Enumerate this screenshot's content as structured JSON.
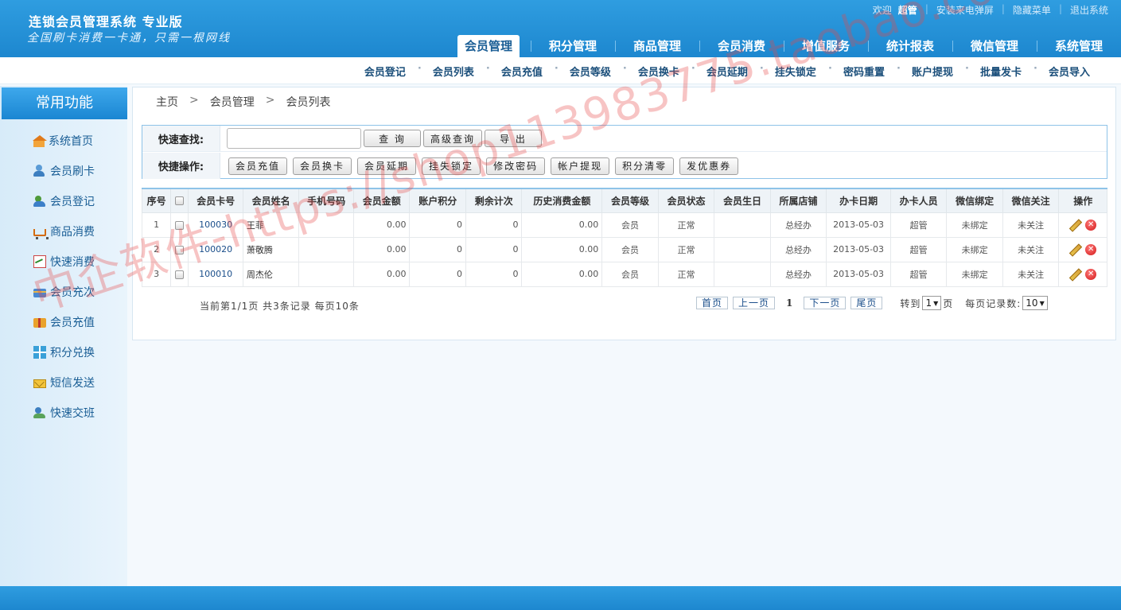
{
  "app": {
    "title": "连锁会员管理系统 专业版",
    "slogan": "全国刷卡消费一卡通，只需一根网线"
  },
  "toplinks": {
    "welcome": "欢迎",
    "user": "超管",
    "install": "安装来电弹屏",
    "hide_menu": "隐藏菜单",
    "logout": "退出系统"
  },
  "mainnav": [
    "会员管理",
    "积分管理",
    "商品管理",
    "会员消费",
    "增值服务",
    "统计报表",
    "微信管理",
    "系统管理"
  ],
  "subnav": [
    "会员登记",
    "会员列表",
    "会员充值",
    "会员等级",
    "会员换卡",
    "会员延期",
    "挂失锁定",
    "密码重置",
    "账户提现",
    "批量发卡",
    "会员导入"
  ],
  "sidebar": {
    "title": "常用功能",
    "items": [
      {
        "label": "系统首页",
        "icon": "home-icon"
      },
      {
        "label": "会员刷卡",
        "icon": "user-card-icon"
      },
      {
        "label": "会员登记",
        "icon": "users-icon"
      },
      {
        "label": "商品消费",
        "icon": "cart-icon"
      },
      {
        "label": "快速消费",
        "icon": "chart-icon"
      },
      {
        "label": "会员充次",
        "icon": "card-icon"
      },
      {
        "label": "会员充值",
        "icon": "box-icon"
      },
      {
        "label": "积分兑换",
        "icon": "gift-icon"
      },
      {
        "label": "短信发送",
        "icon": "mail-icon"
      },
      {
        "label": "快速交班",
        "icon": "shift-icon"
      }
    ]
  },
  "breadcrumb": [
    "主页",
    "会员管理",
    "会员列表"
  ],
  "search": {
    "label": "快速查找:",
    "value": "",
    "query_btn": "查 询",
    "advanced_btn": "高级查询",
    "export_btn": "导 出"
  },
  "quick": {
    "label": "快捷操作:",
    "buttons": [
      "会员充值",
      "会员换卡",
      "会员延期",
      "挂失锁定",
      "修改密码",
      "帐户提现",
      "积分清零",
      "发优惠券"
    ]
  },
  "table": {
    "columns": [
      "序号",
      "",
      "会员卡号",
      "会员姓名",
      "手机号码",
      "会员金额",
      "账户积分",
      "剩余计次",
      "历史消费金额",
      "会员等级",
      "会员状态",
      "会员生日",
      "所属店铺",
      "办卡日期",
      "办卡人员",
      "微信绑定",
      "微信关注",
      "操作"
    ],
    "rows": [
      {
        "no": "1",
        "card": "100030",
        "name": "王菲",
        "phone": "",
        "amount": "0.00",
        "points": "0",
        "times": "0",
        "history": "0.00",
        "level": "会员",
        "status": "正常",
        "birthday": "",
        "store": "总经办",
        "date": "2013-05-03",
        "staff": "超管",
        "wx_bind": "未绑定",
        "wx_follow": "未关注"
      },
      {
        "no": "2",
        "card": "100020",
        "name": "萧敬腾",
        "phone": "",
        "amount": "0.00",
        "points": "0",
        "times": "0",
        "history": "0.00",
        "level": "会员",
        "status": "正常",
        "birthday": "",
        "store": "总经办",
        "date": "2013-05-03",
        "staff": "超管",
        "wx_bind": "未绑定",
        "wx_follow": "未关注"
      },
      {
        "no": "3",
        "card": "100010",
        "name": "周杰伦",
        "phone": "",
        "amount": "0.00",
        "points": "0",
        "times": "0",
        "history": "0.00",
        "level": "会员",
        "status": "正常",
        "birthday": "",
        "store": "总经办",
        "date": "2013-05-03",
        "staff": "超管",
        "wx_bind": "未绑定",
        "wx_follow": "未关注"
      }
    ]
  },
  "pager": {
    "info": "当前第1/1页  共3条记录  每页10条",
    "first": "首页",
    "prev": "上一页",
    "current": "1",
    "next": "下一页",
    "last": "尾页",
    "goto_label": "转到",
    "goto_value": "1",
    "page_unit": "页",
    "per_page_label": "每页记录数:",
    "per_page_value": "10"
  },
  "watermark": "中企软件-https://shop113983775.taobao.com",
  "colors": {
    "header": "#1d87cf",
    "accent": "#1a5e95",
    "sidebar": "#d7ebf9"
  }
}
